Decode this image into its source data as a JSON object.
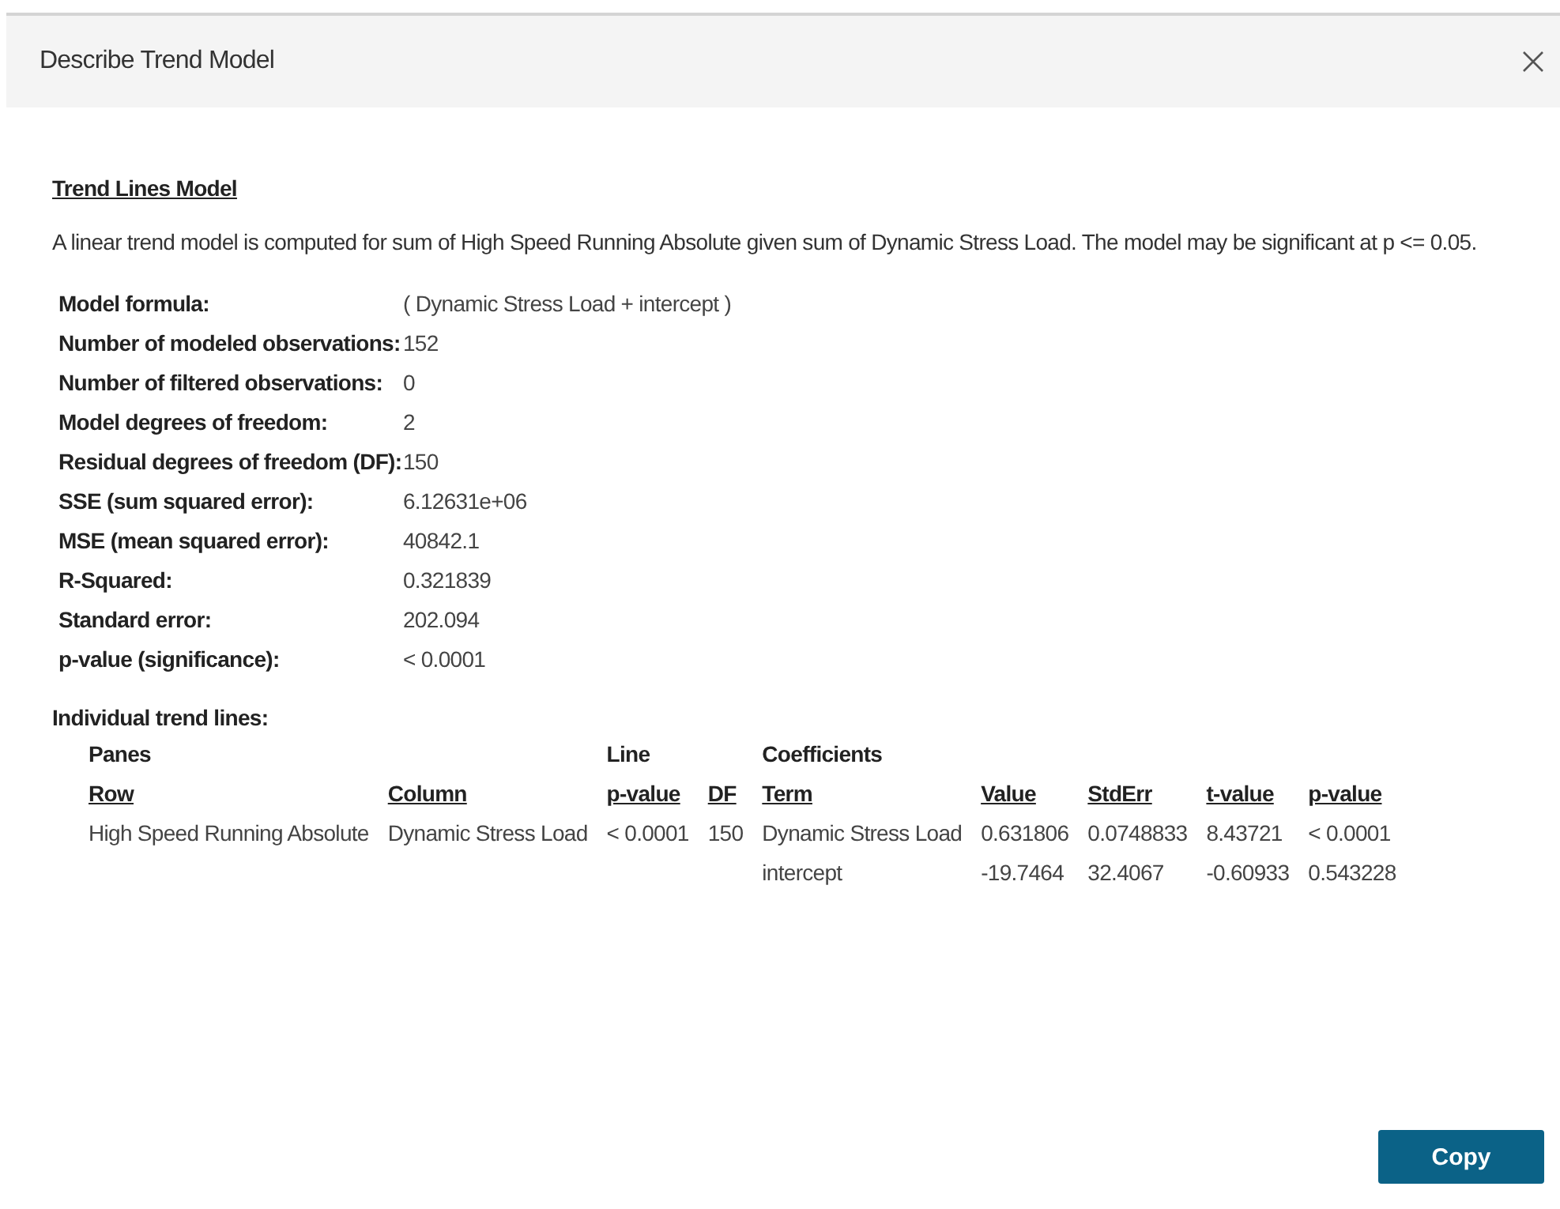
{
  "dialog": {
    "title": "Describe Trend Model"
  },
  "heading": "Trend Lines Model",
  "description": "A linear trend model is computed for sum of High Speed Running Absolute given sum of Dynamic Stress Load.  The model may be significant at p <= 0.05.",
  "stats": [
    {
      "label": "Model formula:",
      "value": "( Dynamic Stress Load + intercept )"
    },
    {
      "label": "Number of modeled observations:",
      "value": "152"
    },
    {
      "label": "Number of filtered observations:",
      "value": "0"
    },
    {
      "label": "Model degrees of freedom:",
      "value": "2"
    },
    {
      "label": "Residual degrees of freedom (DF):",
      "value": "150"
    },
    {
      "label": "SSE (sum squared error):",
      "value": "6.12631e+06"
    },
    {
      "label": "MSE (mean squared error):",
      "value": "40842.1"
    },
    {
      "label": "R-Squared:",
      "value": "0.321839"
    },
    {
      "label": "Standard error:",
      "value": "202.094"
    },
    {
      "label": "p-value (significance):",
      "value": "< 0.0001"
    }
  ],
  "trend_lines": {
    "label": "Individual trend lines:",
    "columns": [
      {
        "group": "Panes",
        "label": "Row"
      },
      {
        "label": "Column"
      },
      {
        "group": "Line",
        "label": "p-value"
      },
      {
        "label": "DF"
      },
      {
        "group": "Coefficients",
        "label": "Term"
      },
      {
        "label": "Value"
      },
      {
        "label": "StdErr"
      },
      {
        "label": "t-value"
      },
      {
        "label": "p-value"
      }
    ],
    "rows": [
      [
        "High Speed Running Absolute",
        "Dynamic Stress Load",
        "< 0.0001",
        "150",
        "Dynamic Stress Load",
        "0.631806",
        "0.0748833",
        "8.43721",
        "< 0.0001"
      ],
      [
        null,
        null,
        null,
        null,
        "intercept",
        "-19.7464",
        "32.4067",
        "-0.60933",
        "0.543228"
      ]
    ]
  },
  "buttons": [
    "Copy"
  ]
}
